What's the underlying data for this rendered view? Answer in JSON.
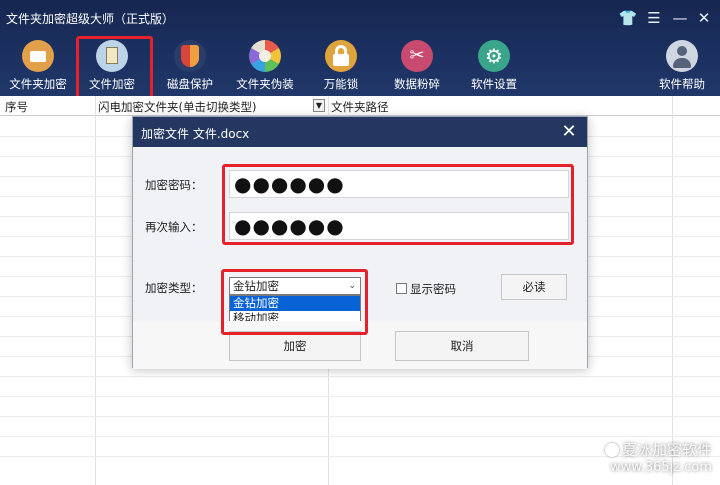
{
  "app": {
    "title": "文件夹加密超级大师（正式版）"
  },
  "window_controls": [
    {
      "name": "skin-icon",
      "glyph": "👕"
    },
    {
      "name": "menu-icon",
      "glyph": "☰"
    },
    {
      "name": "minimize-icon",
      "glyph": "—"
    },
    {
      "name": "close-icon",
      "glyph": "✕"
    }
  ],
  "toolbar": {
    "items": [
      {
        "name": "tool-folder-encrypt",
        "icon": "folder-icon",
        "label": "文件夹加密",
        "color": "#e2a04a"
      },
      {
        "name": "tool-file-encrypt",
        "icon": "document-icon",
        "label": "文件加密",
        "color": "#bcd3e8"
      },
      {
        "name": "tool-disk-protect",
        "icon": "shield-icon",
        "label": "磁盘保护",
        "color": "#d9443a"
      },
      {
        "name": "tool-folder-disguise",
        "icon": "palette-icon",
        "label": "文件夹伪装",
        "color": "#e6e0d2"
      },
      {
        "name": "tool-master-lock",
        "icon": "lock-icon",
        "label": "万能锁",
        "color": "#e0a43c"
      },
      {
        "name": "tool-data-shred",
        "icon": "scissors-icon",
        "label": "数据粉碎",
        "color": "#c84a6e"
      },
      {
        "name": "tool-settings",
        "icon": "gear-icon",
        "label": "软件设置",
        "color": "#3aa58a"
      },
      {
        "name": "tool-help",
        "icon": "user-icon",
        "label": "软件帮助",
        "color": "#cfd6e2"
      }
    ]
  },
  "table": {
    "col_index": "序号",
    "col_type": "闪电加密文件夹(单击切换类型)",
    "col_path": "文件夹路径"
  },
  "dialog": {
    "title": "加密文件  文件.docx",
    "close_glyph": "✕",
    "password_label": "加密密码：",
    "password_value": "●●●●●●",
    "confirm_label": "再次输入：",
    "confirm_value": "●●●●●●",
    "type_label": "加密类型：",
    "type_selected": "金钻加密",
    "type_options": [
      "金钻加密",
      "移动加密"
    ],
    "show_password_label": "显示密码",
    "must_read_label": "必读",
    "encrypt_label": "加密",
    "cancel_label": "取消"
  },
  "watermark": {
    "text": "夏冰加密软件",
    "site": "www.365jz.com"
  }
}
